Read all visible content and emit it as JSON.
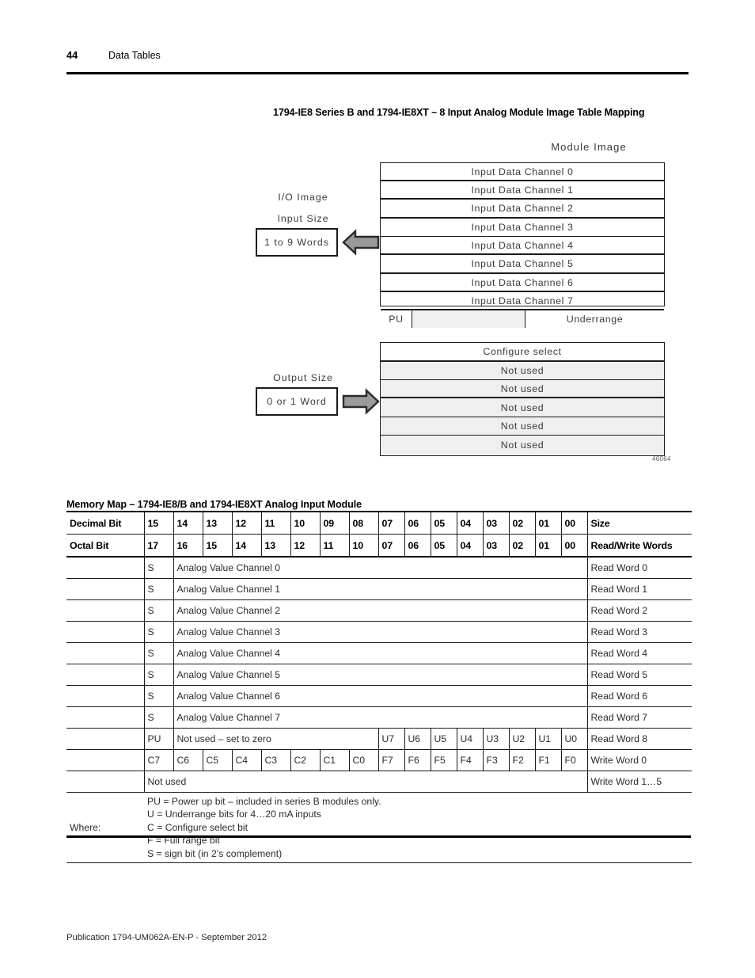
{
  "header": {
    "page_number": "44",
    "section": "Data Tables"
  },
  "figure": {
    "title": "1794-IE8 Series B and 1794-IE8XT – 8 Input Analog Module Image Table Mapping",
    "module_image_label": "Module Image",
    "io_image_label": "I/O Image",
    "input_size_label": "Input Size",
    "input_size_value": "1 to 9 Words",
    "output_size_label": "Output Size",
    "output_size_value": "0 or 1 Word",
    "figure_id": "46064",
    "arrow_in_icon": "arrow-left-icon",
    "arrow_out_icon": "arrow-right-icon",
    "input_rows": [
      "Input Data Channel 0",
      "Input Data Channel 1",
      "Input Data Channel 2",
      "Input Data Channel 3",
      "Input Data Channel 4",
      "Input Data Channel 5",
      "Input Data Channel 6",
      "Input Data Channel 7"
    ],
    "input_status_row": {
      "pu": "PU",
      "middle": "",
      "underrange": "Underrange"
    },
    "output_rows": [
      "Configure select",
      "Not used",
      "Not used",
      "Not used",
      "Not used",
      "Not used"
    ]
  },
  "memory_map": {
    "title": "Memory Map – 1794-IE8/B and 1794-IE8XT Analog Input Module",
    "header_decimal": {
      "label": "Decimal Bit",
      "bits": [
        "15",
        "14",
        "13",
        "12",
        "11",
        "10",
        "09",
        "08",
        "07",
        "06",
        "05",
        "04",
        "03",
        "02",
        "01",
        "00"
      ],
      "size_label": "Size"
    },
    "header_octal": {
      "label": "Octal Bit",
      "bits": [
        "17",
        "16",
        "15",
        "14",
        "13",
        "12",
        "11",
        "10",
        "07",
        "06",
        "05",
        "04",
        "03",
        "02",
        "01",
        "00"
      ],
      "size_label": "Read/Write Words"
    },
    "analog_rows": [
      {
        "sign": "S",
        "desc": "Analog Value Channel 0",
        "word": "Read Word 0"
      },
      {
        "sign": "S",
        "desc": "Analog Value Channel 1",
        "word": "Read Word 1"
      },
      {
        "sign": "S",
        "desc": "Analog Value Channel 2",
        "word": "Read Word 2"
      },
      {
        "sign": "S",
        "desc": "Analog Value Channel 3",
        "word": "Read Word 3"
      },
      {
        "sign": "S",
        "desc": "Analog Value Channel 4",
        "word": "Read Word 4"
      },
      {
        "sign": "S",
        "desc": "Analog Value Channel 5",
        "word": "Read Word 5"
      },
      {
        "sign": "S",
        "desc": "Analog Value Channel 6",
        "word": "Read Word 6"
      },
      {
        "sign": "S",
        "desc": "Analog Value Channel 7",
        "word": "Read Word 7"
      }
    ],
    "read_word_8": {
      "pu": "PU",
      "desc": "Not used – set to zero",
      "bits": [
        "U7",
        "U6",
        "U5",
        "U4",
        "U3",
        "U2",
        "U1",
        "U0"
      ],
      "word": "Read Word 8"
    },
    "write_word_0": {
      "bits": [
        "C7",
        "C6",
        "C5",
        "C4",
        "C3",
        "C2",
        "C1",
        "C0",
        "F7",
        "F6",
        "F5",
        "F4",
        "F3",
        "F2",
        "F1",
        "F0"
      ],
      "word": "Write Word 0"
    },
    "write_word_1_5": {
      "desc": "Not used",
      "word": "Write Word 1…5"
    },
    "where": {
      "label": "Where:",
      "lines": [
        "PU = Power up bit – included in series B modules only.",
        "U = Underrange bits for 4…20 mA inputs",
        "C = Configure select bit",
        "F = Full range bit",
        "S = sign bit (in 2’s complement)"
      ]
    }
  },
  "footer": {
    "publication": "Publication 1794-UM062A-EN-P - September 2012"
  }
}
